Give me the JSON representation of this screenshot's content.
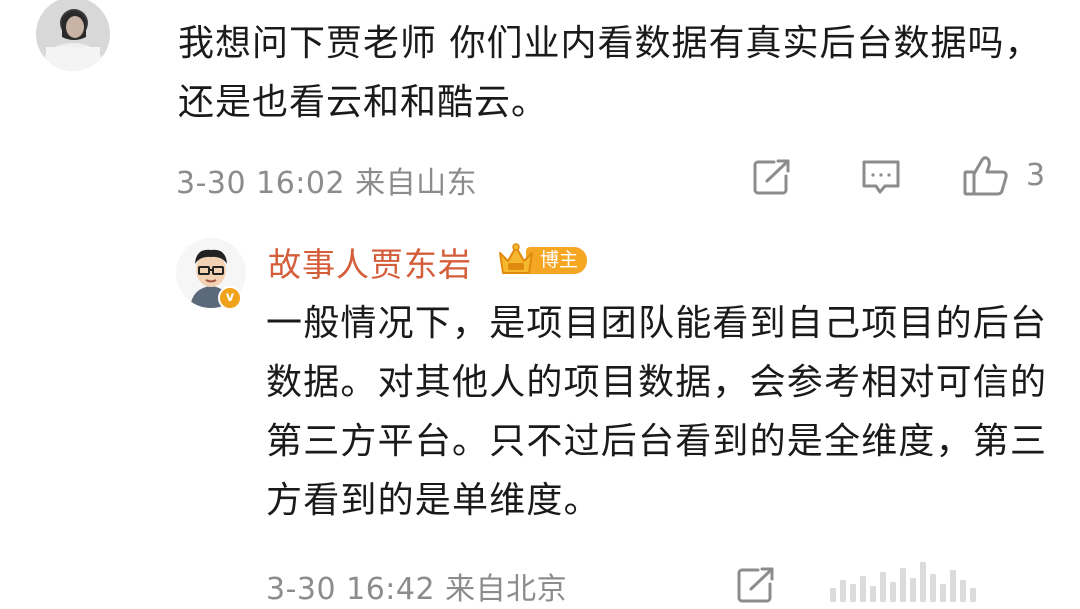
{
  "top_comment": {
    "text": "我想问下贾老师 你们业内看数据有真实后台数据吗，还是也看云和和酷云。",
    "meta": "3-30 16:02 来自山东",
    "like_count": "3",
    "icons": [
      "share-icon",
      "comment-icon",
      "like-icon"
    ]
  },
  "reply": {
    "author": "故事人贾东岩",
    "badge_label": "博主",
    "text": "一般情况下，是项目团队能看到自己项目的后台数据。对其他人的项目数据，会参考相对可信的第三方平台。只不过后台看到的是全维度，第三方看到的是单维度。",
    "meta": "3-30 16:42 来自北京",
    "icons": [
      "share-icon"
    ]
  },
  "colors": {
    "author": "#d45d3a",
    "meta": "#8c8c8c",
    "badge": "#f5a623"
  }
}
